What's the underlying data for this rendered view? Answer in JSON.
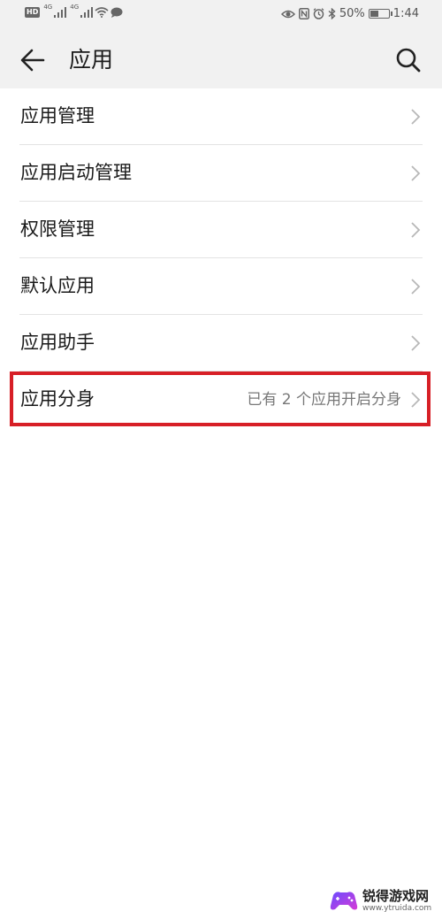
{
  "status_bar": {
    "hd_badge": "HD",
    "network_1": "4G",
    "network_2": "4G",
    "battery_percent_text": "50%",
    "battery_level": 0.5,
    "time": "1:44"
  },
  "header": {
    "title": "应用",
    "back_icon": "arrow-left-icon",
    "search_icon": "search-icon"
  },
  "list": {
    "items": [
      {
        "label": "应用管理",
        "value": ""
      },
      {
        "label": "应用启动管理",
        "value": ""
      },
      {
        "label": "权限管理",
        "value": ""
      },
      {
        "label": "默认应用",
        "value": ""
      },
      {
        "label": "应用助手",
        "value": ""
      },
      {
        "label": "应用分身",
        "value": "已有 2 个应用开启分身"
      }
    ]
  },
  "watermark": {
    "title": "锐得游戏网",
    "url": "www.ytruida.com"
  },
  "colors": {
    "header_bg": "#f1f1f1",
    "highlight": "#d71f26",
    "divider": "#e3e3e3"
  }
}
